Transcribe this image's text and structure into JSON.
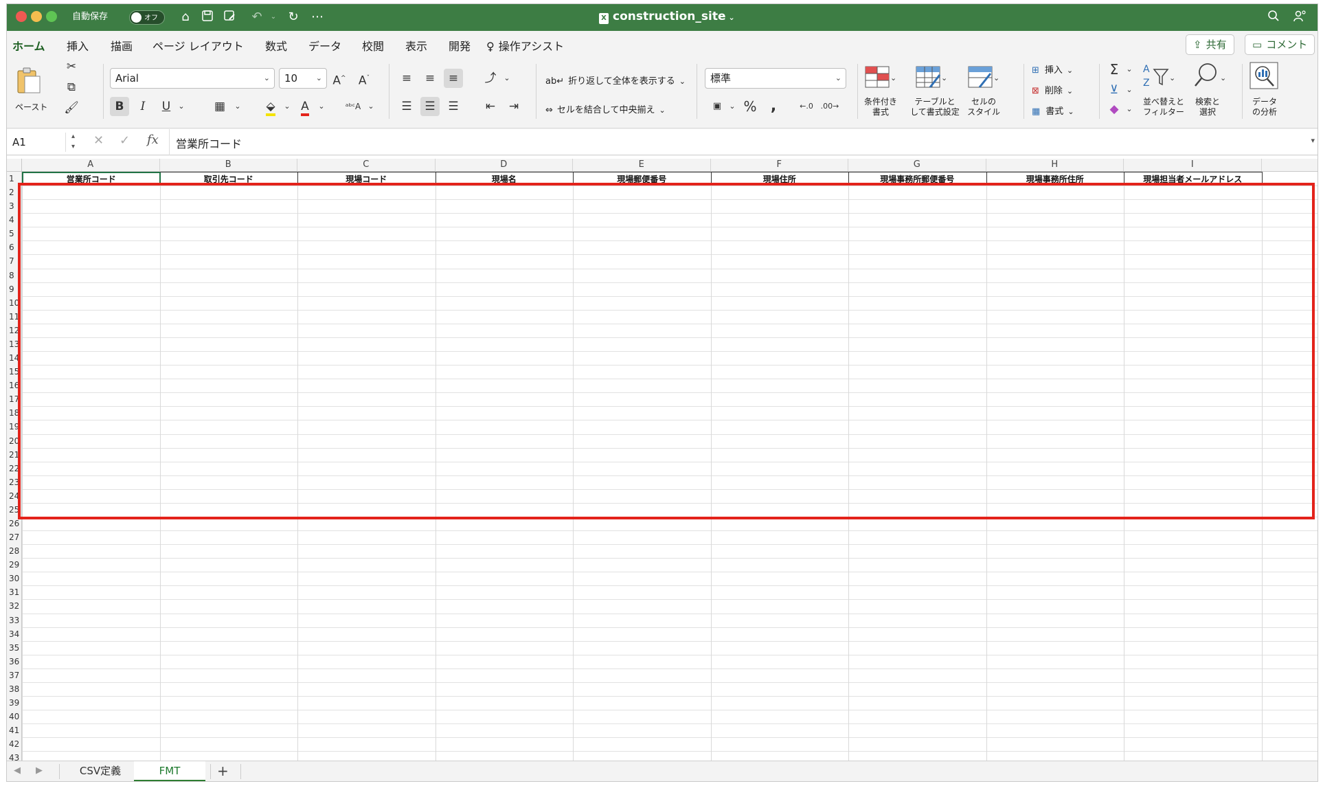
{
  "titlebar": {
    "autosave_label": "自動保存",
    "autosave_state": "オフ",
    "document_title": "construction_site",
    "colors": {
      "bar": "#3d7d44",
      "close": "#ee5a52",
      "minimize": "#f5bd4f",
      "maximize": "#5fc454"
    }
  },
  "tabs": [
    "ホーム",
    "挿入",
    "描画",
    "ページ レイアウト",
    "数式",
    "データ",
    "校閲",
    "表示",
    "開発"
  ],
  "tell_me": "操作アシスト",
  "share_label": "共有",
  "comment_label": "コメント",
  "ribbon": {
    "paste_label": "ペースト",
    "font_name": "Arial",
    "font_size": "10",
    "wrap_text": "折り返して全体を表示する",
    "merge_center": "セルを結合して中央揃え",
    "number_format": "標準",
    "cond_format": [
      "条件付き",
      "書式"
    ],
    "format_table": [
      "テーブルと",
      "して書式設定"
    ],
    "cell_styles": [
      "セルの",
      "スタイル"
    ],
    "insert": "挿入",
    "delete": "削除",
    "format": "書式",
    "sort_filter": [
      "並べ替えと",
      "フィルター"
    ],
    "find_select": [
      "検索と",
      "選択"
    ],
    "analyze": [
      "データ",
      "の分析"
    ]
  },
  "formula_bar": {
    "name_box": "A1",
    "fx": "fx",
    "content": "営業所コード"
  },
  "grid": {
    "columns": [
      "A",
      "B",
      "C",
      "D",
      "E",
      "F",
      "G",
      "H",
      "I"
    ],
    "header_row": [
      "営業所コード",
      "取引先コード",
      "現場コード",
      "現場名",
      "現場郵便番号",
      "現場住所",
      "現場事務所郵便番号",
      "現場事務所住所",
      "現場担当者メールアドレス"
    ],
    "row_numbers": [
      "1",
      "2",
      "3",
      "4",
      "5",
      "6",
      "7",
      "8",
      "9",
      "10",
      "11",
      "12",
      "13",
      "14",
      "15",
      "16",
      "17",
      "18",
      "19",
      "20",
      "21",
      "22",
      "23",
      "24",
      "25",
      "26",
      "27",
      "28",
      "29",
      "30",
      "31",
      "32",
      "33",
      "34",
      "35",
      "36",
      "37",
      "38",
      "39",
      "40",
      "41",
      "42",
      "43"
    ]
  },
  "sheets": [
    "CSV定義",
    "FMT"
  ],
  "active_sheet": "FMT",
  "add_sheet": "+",
  "highlight_color": "#e3231b"
}
